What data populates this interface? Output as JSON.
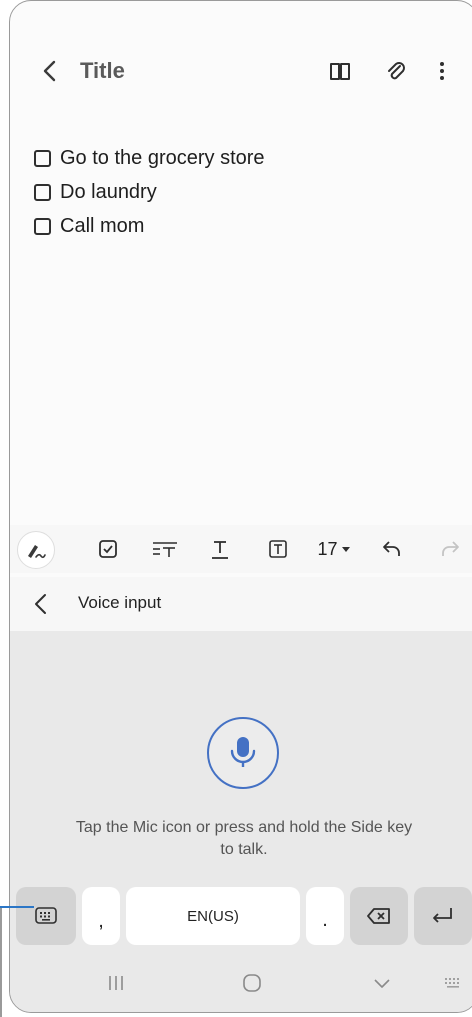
{
  "header": {
    "title": "Title"
  },
  "checklist": [
    {
      "label": "Go to the grocery store"
    },
    {
      "label": "Do laundry"
    },
    {
      "label": "Call mom"
    }
  ],
  "toolbar": {
    "font_size": "17"
  },
  "voice": {
    "header_label": "Voice input",
    "hint_line1": "Tap the Mic icon or press and hold the Side key",
    "hint_line2": "to talk."
  },
  "keyboard": {
    "comma": ",",
    "language": "EN(US)",
    "period": "."
  },
  "colors": {
    "accent": "#4471c4",
    "callout": "#2b76c6",
    "panel": "#e9e9e9"
  }
}
